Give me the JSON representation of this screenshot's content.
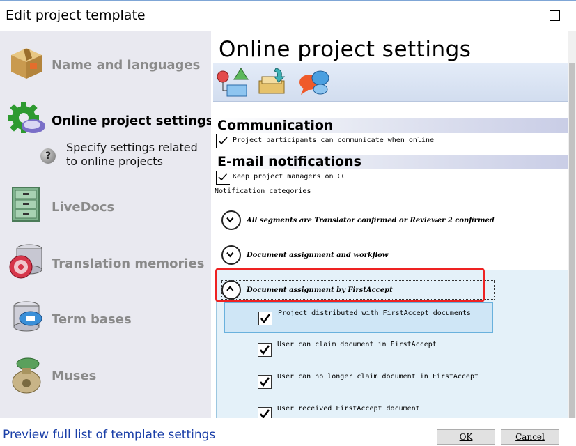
{
  "window": {
    "title": "Edit project template"
  },
  "sidebar": {
    "items": [
      {
        "label": "Name and languages",
        "icon": "package-box-icon",
        "active": false
      },
      {
        "label": "Online project settings",
        "icon": "cloud-gear-icon",
        "active": true
      },
      {
        "label": "LiveDocs",
        "icon": "file-cabinet-icon",
        "active": false
      },
      {
        "label": "Translation memories",
        "icon": "database-disc-icon",
        "active": false
      },
      {
        "label": "Term bases",
        "icon": "term-database-icon",
        "active": false
      },
      {
        "label": "Muses",
        "icon": "muse-sack-icon",
        "active": false
      }
    ],
    "description": "Specify settings related to online projects"
  },
  "main": {
    "title": "Online project settings",
    "toolbar": [
      {
        "name": "workflow-shapes-icon"
      },
      {
        "name": "drawer-arrow-icon"
      },
      {
        "name": "chat-bubbles-icon"
      }
    ],
    "communication": {
      "heading": "Communication",
      "option": "Project participants can communicate when online",
      "checked": true
    },
    "email": {
      "heading": "E-mail notifications",
      "option": "Keep project managers on CC",
      "checked": true,
      "categories_label": "Notification categories"
    },
    "categories": [
      {
        "label": "All segments are Translator confirmed or Reviewer 2 confirmed",
        "expanded": false
      },
      {
        "label": "Document assignment and workflow",
        "expanded": false
      },
      {
        "label": "Document assignment by FirstAccept",
        "expanded": true
      }
    ],
    "sub_items": [
      {
        "label": "Project distributed with FirstAccept documents",
        "checked": true
      },
      {
        "label": "User can claim document in FirstAccept",
        "checked": true
      },
      {
        "label": "User can no longer claim document in FirstAccept",
        "checked": true
      },
      {
        "label": "User received FirstAccept document",
        "checked": true
      }
    ]
  },
  "footer": {
    "preview_link": "Preview full list of template settings",
    "ok_label": "OK",
    "cancel_label": "Cancel"
  },
  "colors": {
    "highlight_red": "#ee2222",
    "link_blue": "#1a3fa8",
    "sidebar_bg": "#e9e9f0",
    "expanded_bg": "#e4f1f9"
  }
}
